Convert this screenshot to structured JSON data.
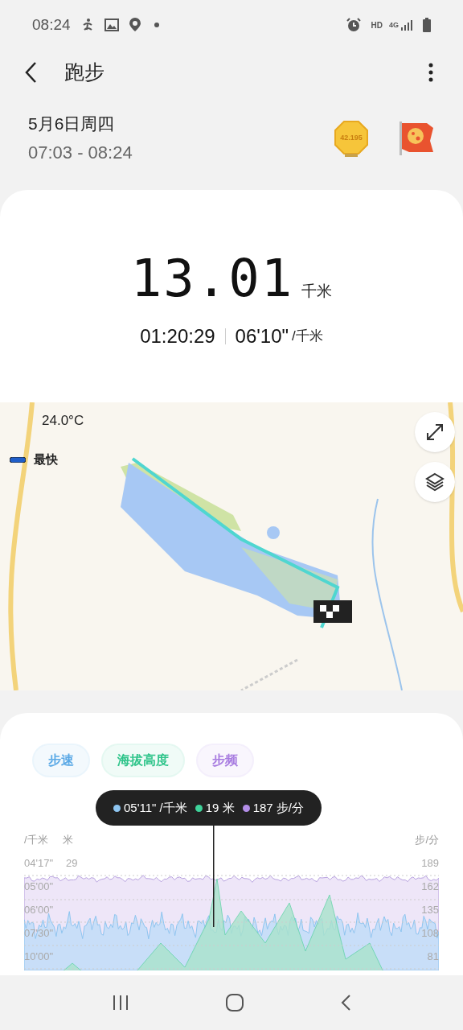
{
  "status_bar": {
    "time": "08:24",
    "network": "4G",
    "hd": "HD"
  },
  "header": {
    "title": "跑步"
  },
  "session": {
    "date": "5月6日周四",
    "time_range": "07:03 - 08:24",
    "badge_text": "42.195"
  },
  "summary": {
    "distance": "13.01",
    "distance_unit": "千米",
    "duration": "01:20:29",
    "pace": "06'10\"",
    "pace_unit": "/千米"
  },
  "map": {
    "temperature": "24.0°C",
    "legend": "最快"
  },
  "chart": {
    "tabs": [
      {
        "label": "步速",
        "on": true,
        "color": "#5aa9e6"
      },
      {
        "label": "海拔高度",
        "on": true,
        "color": "#2ec48a"
      },
      {
        "label": "步频",
        "on": true,
        "color": "#a77be0"
      }
    ],
    "tooltip": [
      {
        "text": "05'11\" /千米",
        "color": "#8ec5f0"
      },
      {
        "text": "19 米",
        "color": "#3ed39a"
      },
      {
        "text": "187 步/分",
        "color": "#b38ee8"
      }
    ],
    "left_unit": "/千米",
    "middle_unit": "米",
    "right_unit": "步/分",
    "left_ticks": [
      "04'17\"",
      "05'00\"",
      "06'00\"",
      "07'30\"",
      "10'00\""
    ],
    "middle_ticks": [
      "29"
    ],
    "right_ticks": [
      "189",
      "162",
      "135",
      "108",
      "81"
    ]
  }
}
